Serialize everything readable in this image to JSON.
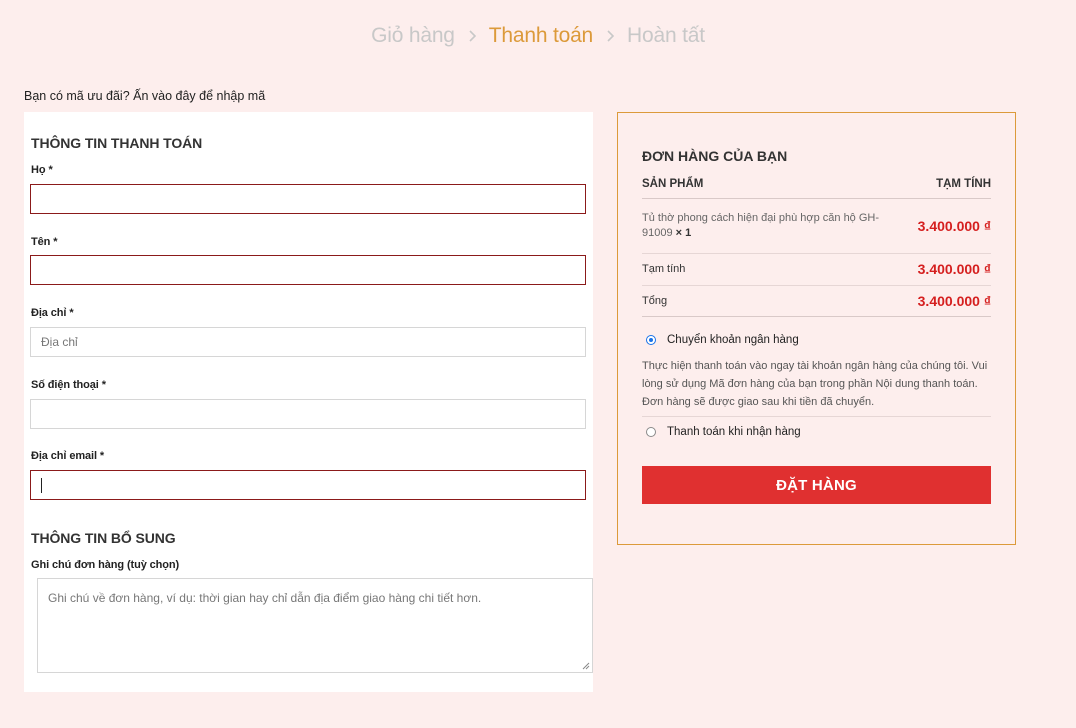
{
  "steps": {
    "cart": "Giỏ hàng",
    "checkout": "Thanh toán",
    "done": "Hoàn tất"
  },
  "coupon": {
    "text": "Bạn có mã ưu đãi? Ấn vào đây để nhập mã"
  },
  "billing": {
    "title": "THÔNG TIN THANH TOÁN",
    "last_name": {
      "label": "Họ",
      "value": "",
      "placeholder": ""
    },
    "first_name": {
      "label": "Tên",
      "value": "",
      "placeholder": ""
    },
    "address": {
      "label": "Địa chỉ",
      "value": "",
      "placeholder": "Địa chỉ"
    },
    "phone": {
      "label": "Số điện thoại",
      "value": "",
      "placeholder": ""
    },
    "email": {
      "label": "Địa chỉ email",
      "value": "",
      "placeholder": ""
    },
    "required_mark": "*"
  },
  "additional": {
    "title": "THÔNG TIN BỔ SUNG",
    "notes_label": "Ghi chú đơn hàng (tuỳ chọn)",
    "notes_placeholder": "Ghi chú về đơn hàng, ví dụ: thời gian hay chỉ dẫn địa điểm giao hàng chi tiết hơn."
  },
  "order": {
    "title": "ĐƠN HÀNG CỦA BẠN",
    "col_product": "SẢN PHẨM",
    "col_subtotal": "TẠM TÍNH",
    "item": {
      "name": "Tủ thờ phong cách hiện đại phù hợp căn hộ GH-91009",
      "qty": "× 1",
      "price": "3.400.000 ₫"
    },
    "subtotal_label": "Tạm tính",
    "subtotal_value": "3.400.000 ₫",
    "total_label": "Tổng",
    "total_value": "3.400.000 ₫",
    "payment": {
      "bank_label": "Chuyển khoản ngân hàng",
      "bank_desc": "Thực hiện thanh toán vào ngay tài khoản ngân hàng của chúng tôi. Vui lòng sử dụng Mã đơn hàng của bạn trong phần Nội dung thanh toán. Đơn hàng sẽ được giao sau khi tiền đã chuyển.",
      "cod_label": "Thanh toán khi nhận hàng",
      "selected": "bank"
    },
    "place_order": "ĐẶT HÀNG"
  },
  "colors": {
    "background": "#fdeeed",
    "accent": "#dc9a3a",
    "price": "#d51f1f",
    "button": "#e03030",
    "invalid_border": "#8b1a1a"
  }
}
